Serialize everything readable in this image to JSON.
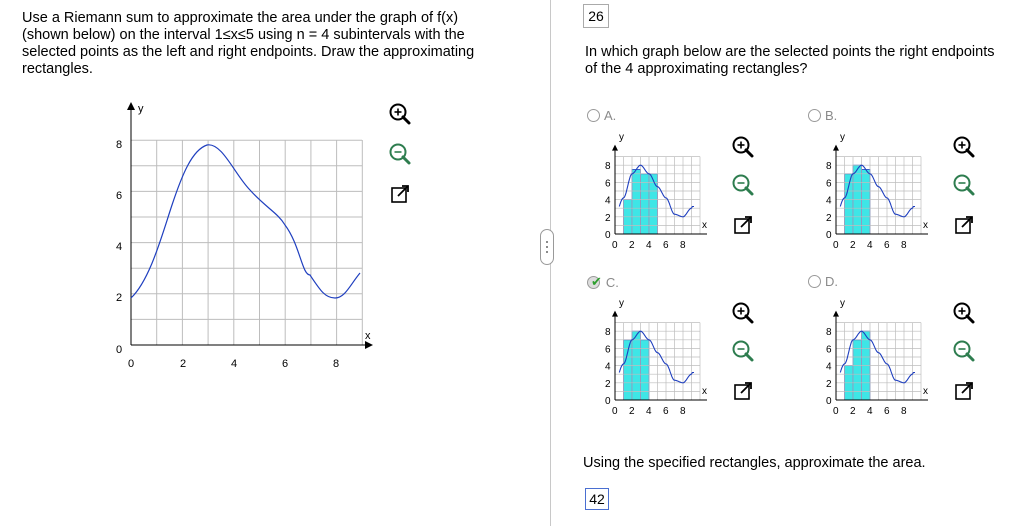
{
  "problem": {
    "line1": "Use a Riemann sum to approximate the area under the graph of f(x)",
    "line2": "(shown below) on the interval 1≤x≤5 using n = 4 subintervals with the",
    "line3": "selected points as the left and right endpoints. Draw the approximating",
    "line4": "rectangles."
  },
  "question_number": "26",
  "question": {
    "line1": "In which graph below are the selected points the right endpoints",
    "line2": "of the 4 approximating rectangles?"
  },
  "main_graph": {
    "y_label": "y",
    "x_label": "x",
    "x_ticks": [
      "0",
      "2",
      "4",
      "6",
      "8"
    ],
    "y_ticks": [
      "0",
      "2",
      "4",
      "6",
      "8"
    ]
  },
  "options": [
    {
      "label": "A.",
      "selected": false
    },
    {
      "label": "B.",
      "selected": false
    },
    {
      "label": "C.",
      "selected": true
    },
    {
      "label": "D.",
      "selected": false
    }
  ],
  "small_graph": {
    "y_label": "y",
    "x_label": "x",
    "y_ticks": [
      "8",
      "6",
      "4",
      "2",
      "0"
    ],
    "x_ticks": [
      "0",
      "2",
      "4",
      "6",
      "8"
    ]
  },
  "rectangle_heights": {
    "A": [
      4,
      7.5,
      7,
      7
    ],
    "B": [
      7,
      8,
      7.5,
      0
    ],
    "C": [
      7,
      8,
      7,
      0
    ],
    "D": [
      4,
      7,
      8,
      0
    ]
  },
  "approximate_prompt": "Using the specified rectangles, approximate the area.",
  "answer_value": "42",
  "colors": {
    "curve": "#1f3fbf",
    "rect_fill": "#3ee6e6",
    "rect_stroke": "#1f3fbf",
    "grid": "#bdbdbd",
    "check": "#2e9e2e"
  },
  "icons": [
    "zoom-in-icon",
    "zoom-out-icon",
    "open-new-window-icon"
  ]
}
